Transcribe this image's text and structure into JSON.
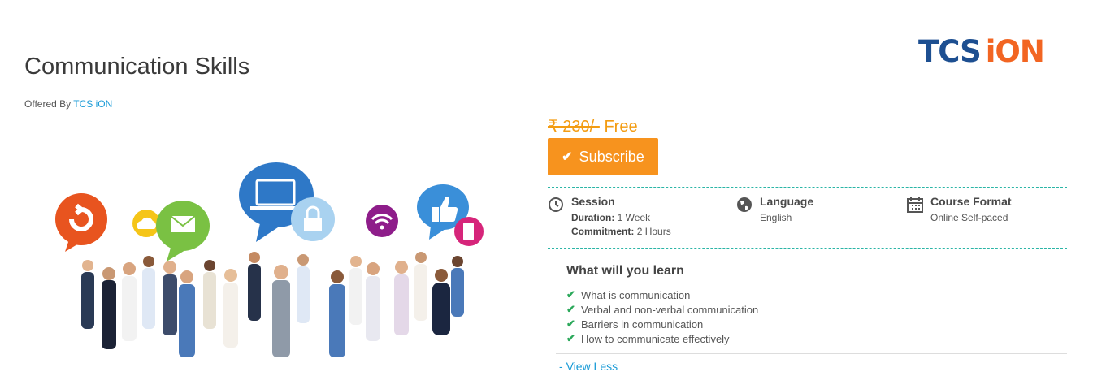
{
  "course": {
    "title": "Communication Skills",
    "offered_by_label": "Offered By",
    "offered_by_link": "TCS iON"
  },
  "logo": {
    "part1": "TCS",
    "part2": "iON"
  },
  "pricing": {
    "old_price": "₹ 230/-",
    "new_price": "Free",
    "subscribe_label": "Subscribe"
  },
  "details": {
    "session": {
      "heading": "Session",
      "duration_label": "Duration:",
      "duration_value": "1 Week",
      "commitment_label": "Commitment:",
      "commitment_value": "2 Hours",
      "icon": "clock-icon"
    },
    "language": {
      "heading": "Language",
      "value": "English",
      "icon": "globe-icon"
    },
    "format": {
      "heading": "Course Format",
      "value": "Online Self-paced",
      "icon": "calendar-icon"
    }
  },
  "learn": {
    "heading": "What will you learn",
    "items": [
      "What is communication",
      "Verbal and non-verbal communication",
      "Barriers in communication",
      "How to communicate effectively"
    ],
    "toggle_label": "View Less"
  },
  "colors": {
    "accent_orange": "#f7931e",
    "link_blue": "#1a9bd7",
    "dash_teal": "#2bb5a6",
    "check_green": "#2ba85a"
  }
}
